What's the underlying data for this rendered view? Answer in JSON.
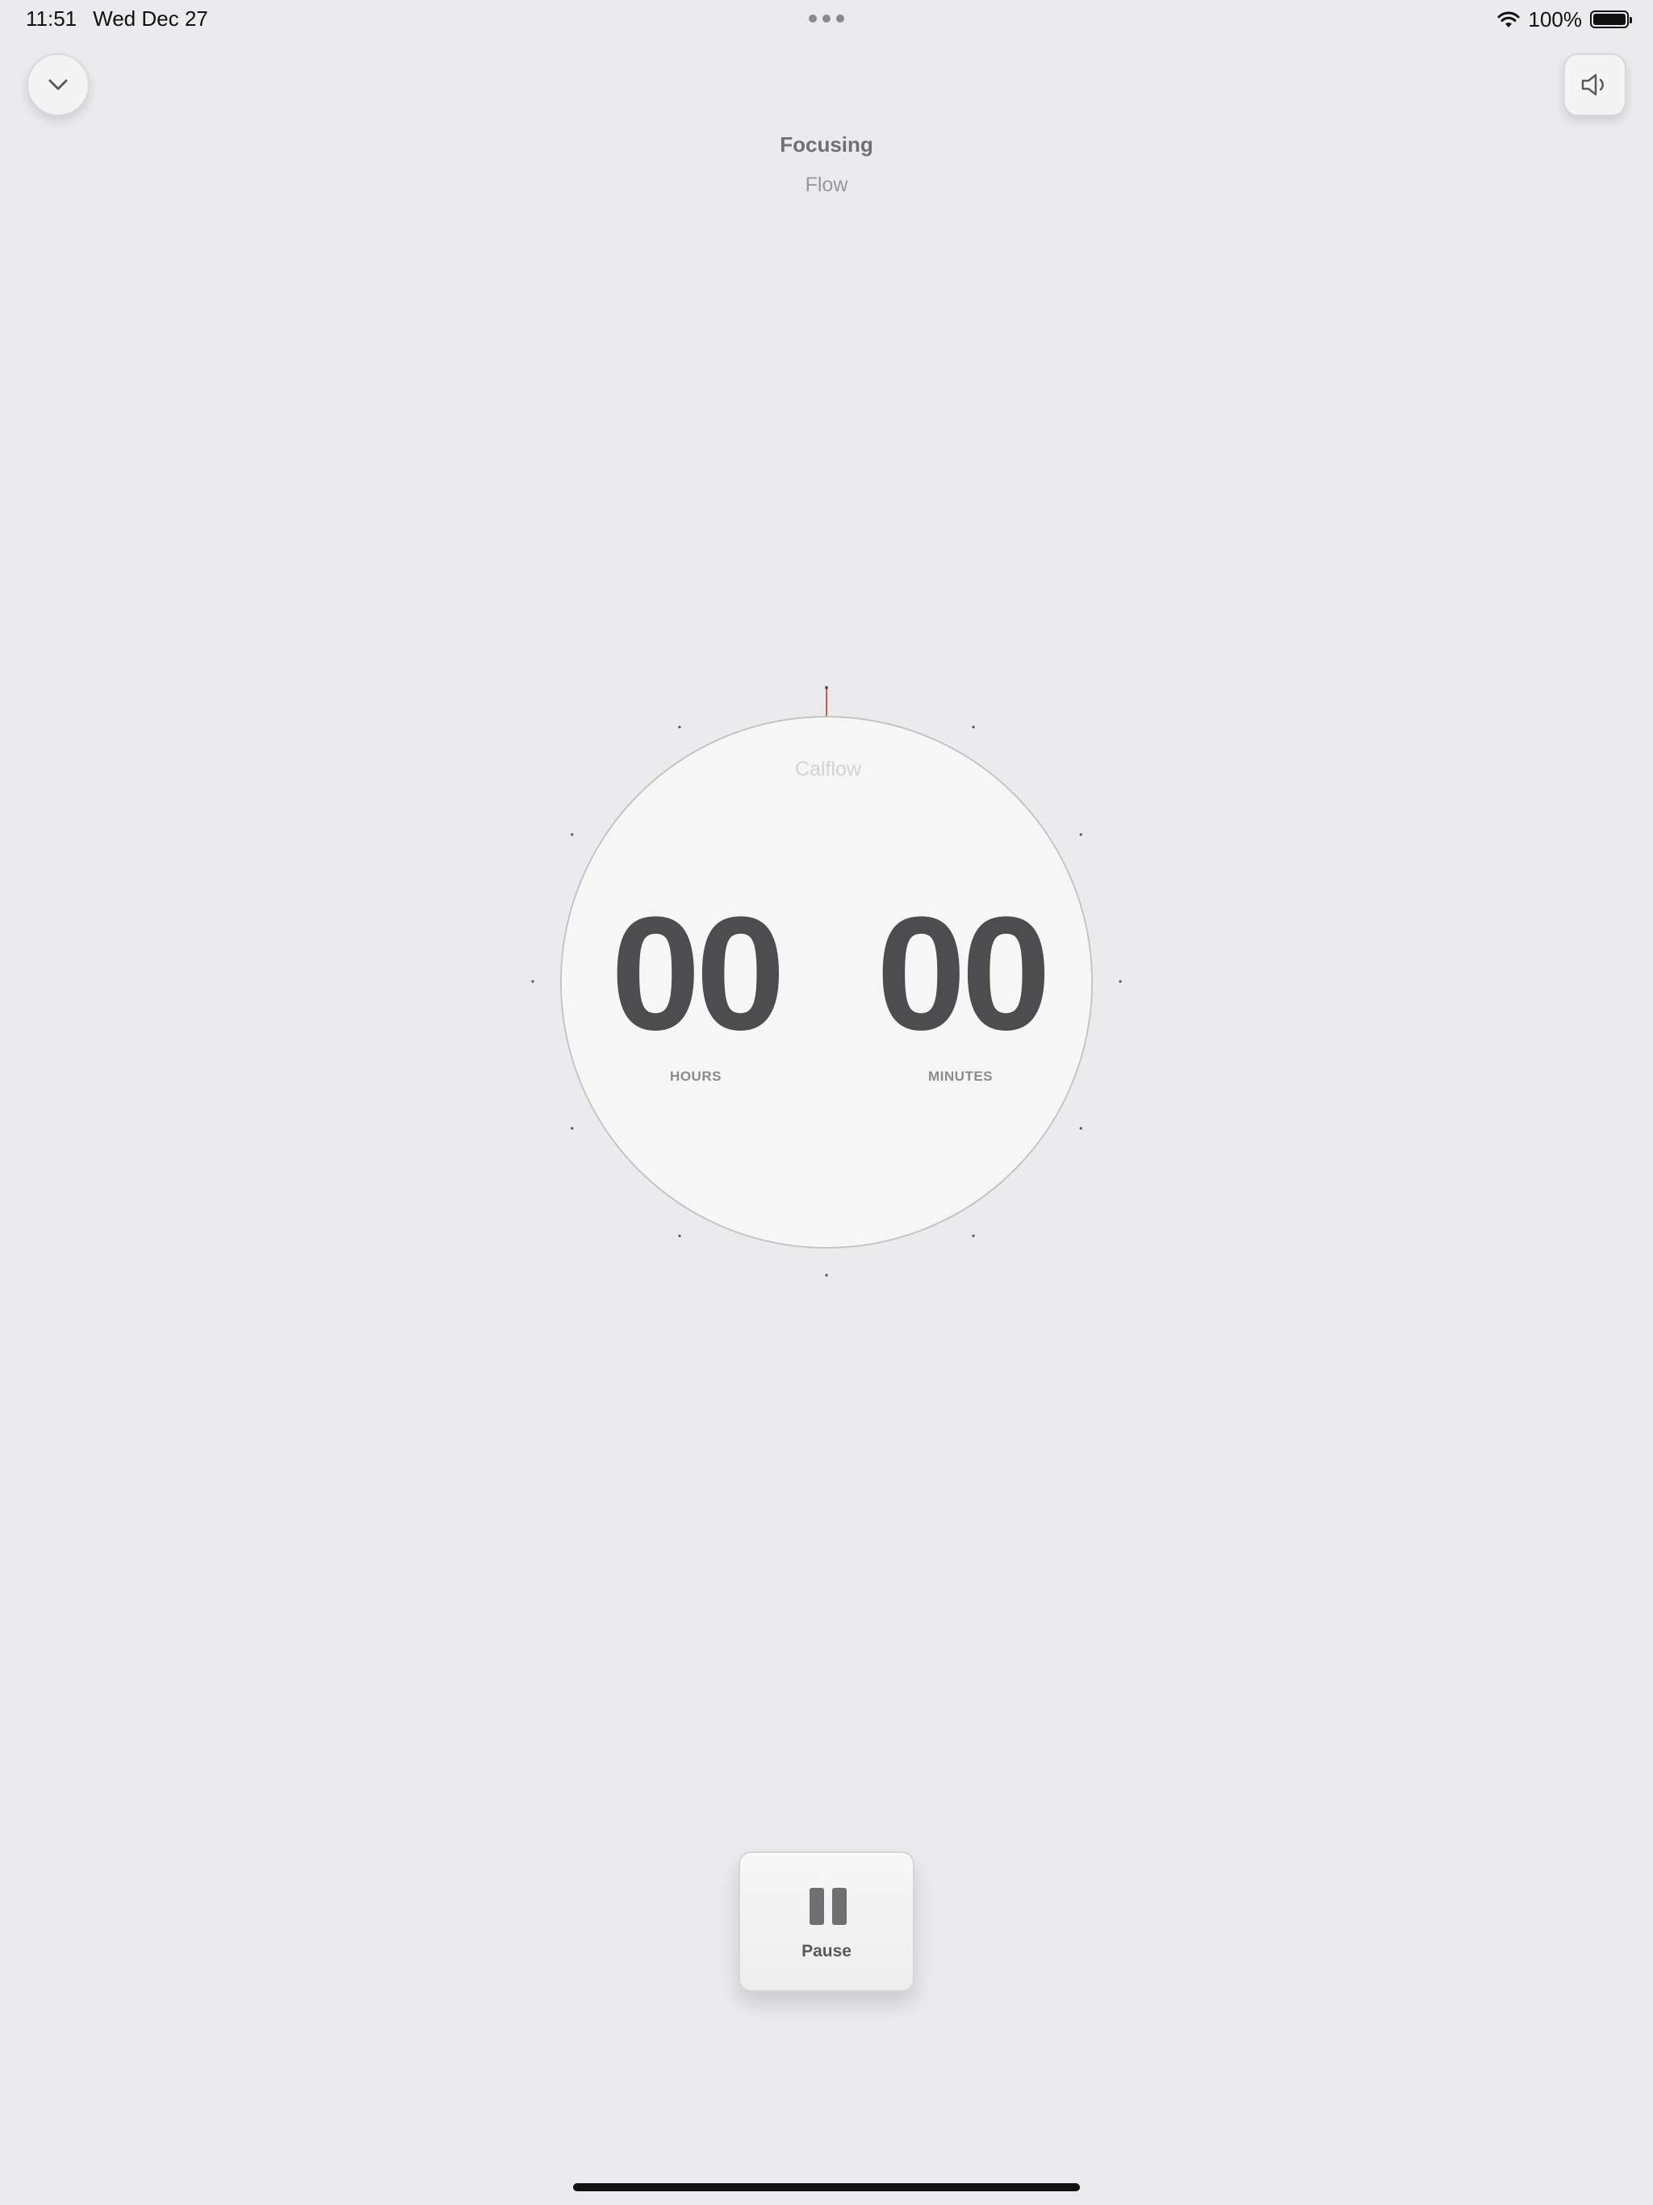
{
  "status_bar": {
    "time": "11:51",
    "date": "Wed Dec 27",
    "battery": "100%",
    "battery_level": 1.0,
    "icons": [
      "more-dots-icon",
      "wifi-icon",
      "battery-icon"
    ]
  },
  "header": {
    "title": "Focusing",
    "subtitle": "Flow"
  },
  "top_buttons": {
    "left_icon": "chevron-down-icon",
    "right_icon": "speaker-icon"
  },
  "timer": {
    "brand": "Calflow",
    "hours": "00",
    "minutes": "00",
    "hours_label": "HOURS",
    "minutes_label": "MINUTES"
  },
  "pause_button": {
    "label": "Pause",
    "icon": "pause-icon"
  },
  "colors": {
    "background": "#ebebee",
    "dial": "#f6f6f6",
    "digits": "#4d4d4f",
    "indicator": "#d9534f"
  }
}
